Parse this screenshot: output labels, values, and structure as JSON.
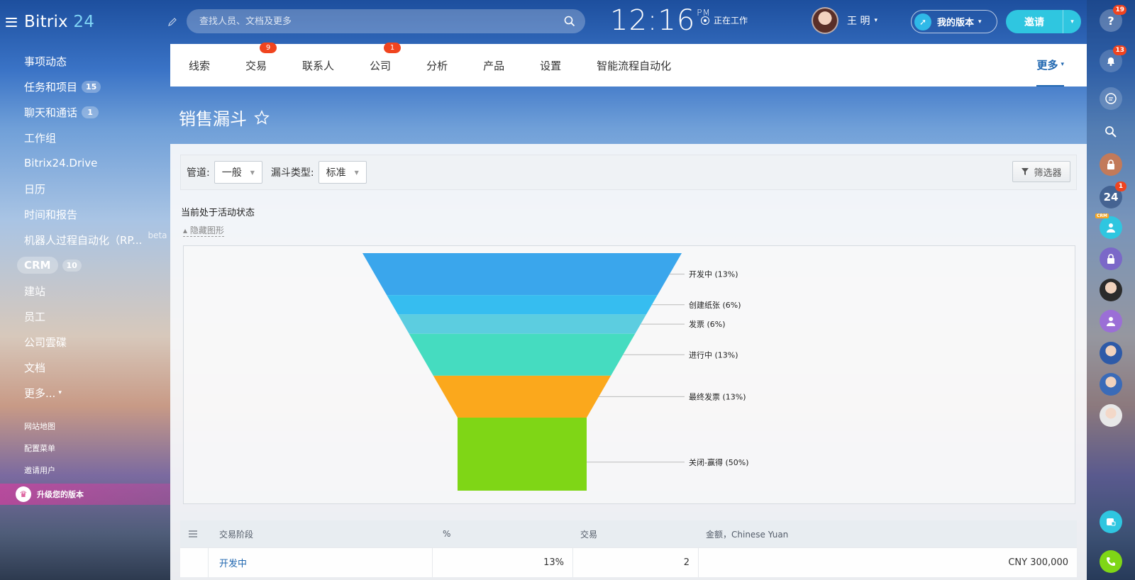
{
  "app": {
    "logo_text": "Bitrix",
    "logo_num": "24"
  },
  "sidebar": {
    "items": [
      {
        "label": "事项动态"
      },
      {
        "label": "任务和项目",
        "badge": "15"
      },
      {
        "label": "聊天和通话",
        "badge": "1"
      },
      {
        "label": "工作组"
      },
      {
        "label": "Bitrix24.Drive"
      },
      {
        "label": "日历"
      },
      {
        "label": "时间和报告"
      },
      {
        "label": "机器人过程自动化（RP...",
        "suffix": "beta"
      },
      {
        "label": "CRM",
        "badge": "10"
      },
      {
        "label": "建站"
      },
      {
        "label": "员工"
      },
      {
        "label": "公司雲碟"
      },
      {
        "label": "文档"
      },
      {
        "label": "更多..."
      }
    ],
    "small_links": [
      "网站地图",
      "配置菜单",
      "邀请用户"
    ],
    "upgrade_label": "升级您的版本"
  },
  "header": {
    "search_placeholder": "查找人员、文档及更多",
    "clock_time": "12:16",
    "clock_ampm": "PM",
    "work_status": "正在工作",
    "user_name": "王 明",
    "my_version": "我的版本",
    "invite": "邀请"
  },
  "rail": {
    "help_badge": "19",
    "notify_badge": "13",
    "b24_badge": "1",
    "b24_label": "24",
    "crm_tag": "CRM"
  },
  "tabs": [
    {
      "label": "线索"
    },
    {
      "label": "交易",
      "badge": "9"
    },
    {
      "label": "联系人"
    },
    {
      "label": "公司",
      "badge": "1"
    },
    {
      "label": "分析"
    },
    {
      "label": "产品"
    },
    {
      "label": "设置"
    },
    {
      "label": "智能流程自动化"
    }
  ],
  "tab_more": "更多",
  "page_title": "销售漏斗",
  "filters": {
    "pipeline_label": "管道:",
    "pipeline_value": "一般",
    "funnel_type_label": "漏斗类型:",
    "funnel_type_value": "标准",
    "filter_button": "筛选器"
  },
  "active_label": "当前处于活动状态",
  "hide_chart": "隐藏图形",
  "chart_data": {
    "type": "funnel",
    "series": [
      {
        "label": "开发中 (13%)",
        "value": 13,
        "color": "#3aa6ec"
      },
      {
        "label": "创建纸张 (6%)",
        "value": 6,
        "color": "#36bdf0"
      },
      {
        "label": "发票 (6%)",
        "value": 6,
        "color": "#5ccde0"
      },
      {
        "label": "进行中 (13%)",
        "value": 13,
        "color": "#45dcc0"
      },
      {
        "label": "最终发票 (13%)",
        "value": 13,
        "color": "#fba81c"
      },
      {
        "label": "关闭-赢得 (50%)",
        "value": 50,
        "color": "#7fd616"
      }
    ]
  },
  "table": {
    "headers": [
      "交易阶段",
      "%",
      "交易",
      "金额，Chinese Yuan"
    ],
    "rows": [
      {
        "stage": "开发中",
        "percent": "13%",
        "deals": "2",
        "amount": "CNY 300,000"
      }
    ]
  }
}
